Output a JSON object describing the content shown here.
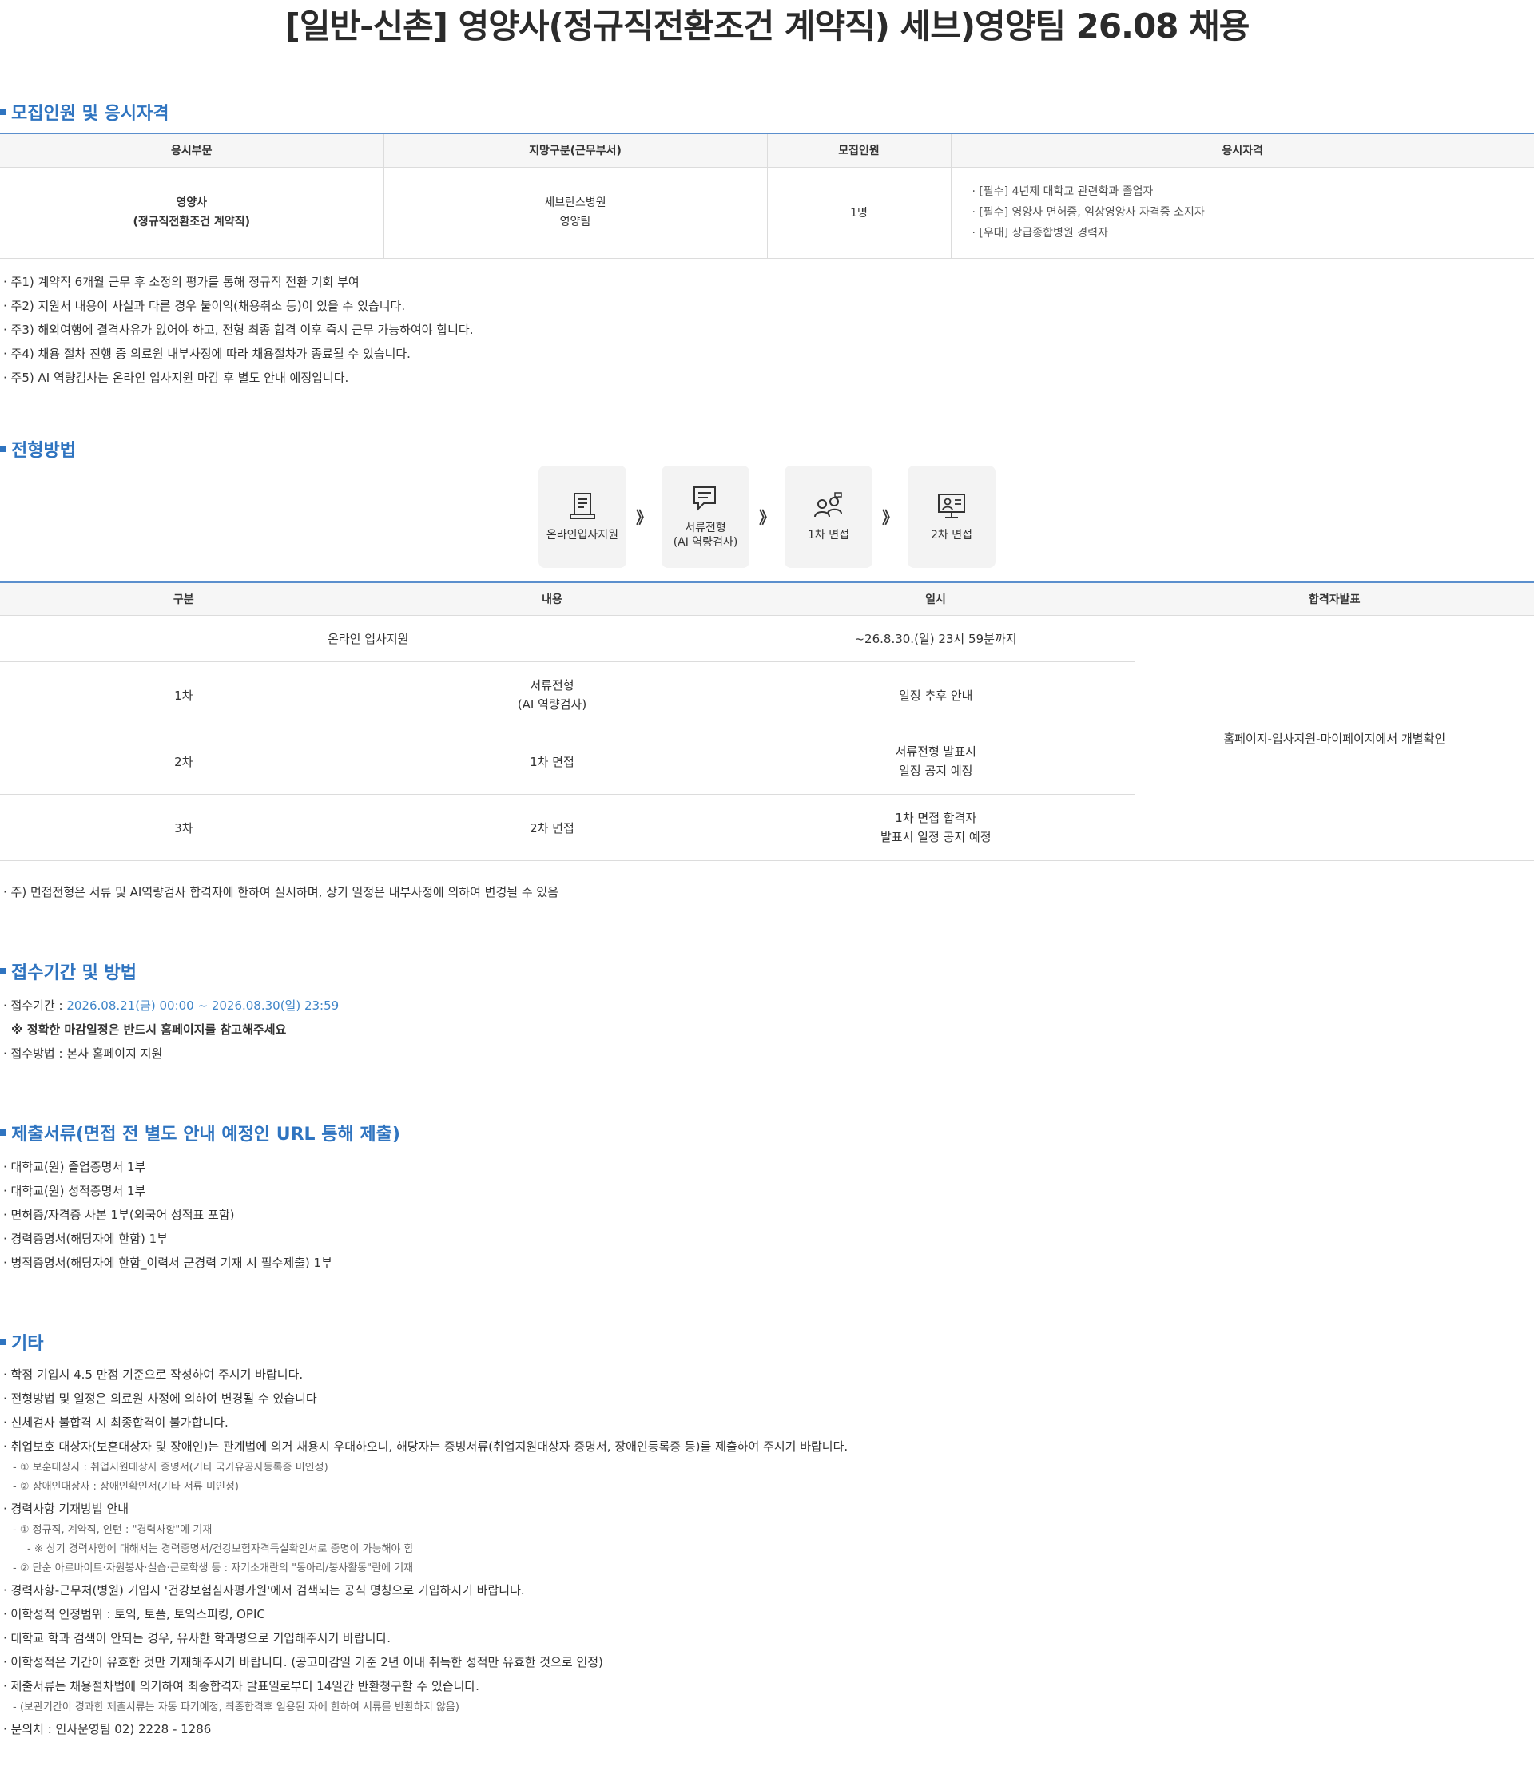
{
  "title": "[일반-신촌] 영양사(정규직전환조건 계약직) 세브)영양팀 26.08 채용",
  "section1": {
    "heading": "모집인원 및 응시자격",
    "headers": [
      "응시부문",
      "지망구분(근무부서)",
      "모집인원",
      "응시자격"
    ],
    "row": {
      "dept_line1": "영양사",
      "dept_line2": "(정규직전환조건 계약직)",
      "place_line1": "세브란스병원",
      "place_line2": "영양팀",
      "count": "1명",
      "qualifications": [
        "· [필수] 4년제 대학교 관련학과 졸업자",
        "· [필수] 영양사 면허증, 임상영양사 자격증 소지자",
        "· [우대] 상급종합병원 경력자"
      ]
    },
    "notes": [
      "· 주1) 계약직 6개월 근무 후 소정의 평가를 통해 정규직 전환 기회 부여",
      "· 주2) 지원서 내용이 사실과 다른 경우 불이익(채용취소 등)이 있을 수 있습니다.",
      "· 주3) 해외여행에 결격사유가 없어야 하고, 전형 최종 합격 이후 즉시 근무 가능하여야 합니다.",
      "· 주4) 채용 절차 진행 중 의료원 내부사정에 따라 채용절차가 종료될 수 있습니다.",
      "· 주5) AI 역량검사는 온라인 입사지원 마감 후 별도 안내 예정입니다."
    ]
  },
  "section2": {
    "heading": "전형방법",
    "steps": [
      {
        "line1": "온라인입사지원",
        "line2": "",
        "icon": "document-icon"
      },
      {
        "line1": "서류전형",
        "line2": "(AI 역량검사)",
        "icon": "chat-document-icon"
      },
      {
        "line1": "1차 면접",
        "line2": "",
        "icon": "interview-people-icon"
      },
      {
        "line1": "2차 면접",
        "line2": "",
        "icon": "monitor-interview-icon"
      }
    ],
    "arrow": "》",
    "headers": [
      "구분",
      "내용",
      "일시",
      "합격자발표"
    ],
    "rows": [
      {
        "col1": "온라인 입사지원",
        "content1": "",
        "content2": "",
        "date1": "~26.8.30.(일) 23시 59분까지",
        "date2": ""
      },
      {
        "col1": "1차",
        "content1": "서류전형",
        "content2": "(AI 역량검사)",
        "date1": "일정 추후 안내",
        "date2": ""
      },
      {
        "col1": "2차",
        "content1": "1차 면접",
        "content2": "",
        "date1": "서류전형 발표시",
        "date2": "일정 공지 예정"
      },
      {
        "col1": "3차",
        "content1": "2차 면접",
        "content2": "",
        "date1": "1차 면접 합격자",
        "date2": "발표시 일정 공지 예정"
      }
    ],
    "announce": "홈페이지-입사지원-마이페이지에서 개별확인",
    "note": "· 주) 면접전형은 서류 및 AI역량검사 합격자에 한하여 실시하며, 상기 일정은 내부사정에 의하여 변경될 수 있음"
  },
  "section3": {
    "heading": "접수기간 및 방법",
    "period_label": "· 접수기간 : ",
    "period_value": "2026.08.21(금) 00:00 ~ 2026.08.30(일) 23:59",
    "period_note": "※ 정확한 마감일정은 반드시 홈페이지를 참고해주세요",
    "method": "· 접수방법 : 본사 홈페이지 지원"
  },
  "section4": {
    "heading": "제출서류(면접 전 별도 안내 예정인 URL 통해 제출)",
    "items": [
      "· 대학교(원) 졸업증명서 1부",
      "· 대학교(원) 성적증명서 1부",
      "· 면허증/자격증 사본 1부(외국어 성적표 포함)",
      "· 경력증명서(해당자에 한함) 1부",
      "· 병적증명서(해당자에 한함_이력서 군경력 기재 시 필수제출) 1부"
    ]
  },
  "section5": {
    "heading": "기타",
    "items": [
      {
        "text": "· 학점 기입시 4.5 만점 기준으로 작성하여 주시기 바랍니다.",
        "level": 0
      },
      {
        "text": "· 전형방법 및 일정은 의료원 사정에 의하여 변경될 수 있습니다",
        "level": 0
      },
      {
        "text": "· 신체검사 불합격 시 최종합격이 불가합니다.",
        "level": 0
      },
      {
        "text": "· 취업보호 대상자(보훈대상자 및 장애인)는 관계법에 의거 채용시 우대하오니, 해당자는 증빙서류(취업지원대상자 증명서, 장애인등록증 등)를 제출하여 주시기 바랍니다.",
        "level": 0
      },
      {
        "text": "- ① 보훈대상자 : 취업지원대상자 증명서(기타 국가유공자등록증 미인정)",
        "level": 1
      },
      {
        "text": "- ② 장애인대상자 : 장애인확인서(기타 서류 미인정)",
        "level": 1
      },
      {
        "text": "· 경력사항 기재방법 안내",
        "level": 0
      },
      {
        "text": "- ① 정규직, 계약직, 인턴 : \"경력사항\"에 기재",
        "level": 1
      },
      {
        "text": "- ※ 상기 경력사항에 대해서는 경력증명서/건강보험자격득실확인서로 증명이 가능해야 함",
        "level": 2
      },
      {
        "text": "- ② 단순 아르바이트·자원봉사·실습·근로학생 등 : 자기소개란의 \"동아리/봉사활동\"란에 기재",
        "level": 1
      },
      {
        "text": "· 경력사항-근무처(병원) 기입시 '건강보험심사평가원'에서 검색되는 공식 명칭으로 기입하시기 바랍니다.",
        "level": 0
      },
      {
        "text": "· 어학성적 인정범위 : 토익, 토플, 토익스피킹, OPIC",
        "level": 0
      },
      {
        "text": "· 대학교 학과 검색이 안되는 경우, 유사한 학과명으로 기입해주시기 바랍니다.",
        "level": 0
      },
      {
        "text": "· 어학성적은 기간이 유효한 것만 기재해주시기 바랍니다. (공고마감일 기준 2년 이내 취득한 성적만 유효한 것으로 인정)",
        "level": 0
      },
      {
        "text": "· 제출서류는 채용절차법에 의거하여 최종합격자 발표일로부터 14일간 반환청구할 수 있습니다.",
        "level": 0
      },
      {
        "text": "- (보관기간이 경과한 제출서류는 자동 파기예정, 최종합격후 임용된 자에 한하여 서류를 반환하지 않음)",
        "level": 1
      },
      {
        "text": "· 문의처 : 인사운영팀 02) 2228 - 1286",
        "level": 0
      }
    ]
  }
}
